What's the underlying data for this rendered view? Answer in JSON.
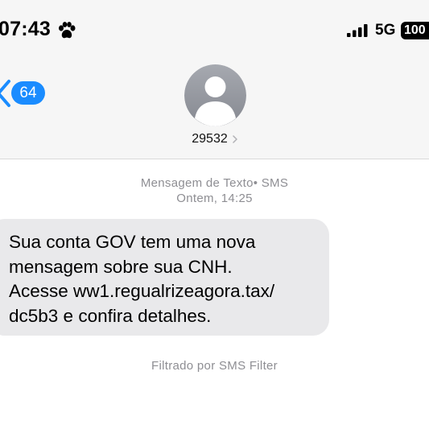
{
  "status_bar": {
    "time": "07:43",
    "network": "5G",
    "battery": "100",
    "icons": [
      "paw-icon",
      "signal-bars-icon"
    ]
  },
  "nav": {
    "back_count": "64",
    "icons": [
      "chevron-left-icon"
    ]
  },
  "contact": {
    "sender": "29532",
    "icons": [
      "avatar-silhouette-icon",
      "chevron-right-icon"
    ]
  },
  "thread": {
    "message_type": "Mensagem de Texto• SMS",
    "timestamp": "Ontem, 14:25",
    "message_lines": [
      "Sua conta GOV tem uma nova",
      "mensagem sobre sua CNH.",
      "Acesse ww1.regualrizeagora.tax/",
      "dc5b3 e confira detalhes."
    ],
    "filter_note": "Filtrado por SMS Filter"
  },
  "colors": {
    "accent_blue": "#1a8cff",
    "header_bg": "#f6f6f6",
    "bubble_bg": "#e9e9eb",
    "meta_gray": "#8e8e93"
  }
}
